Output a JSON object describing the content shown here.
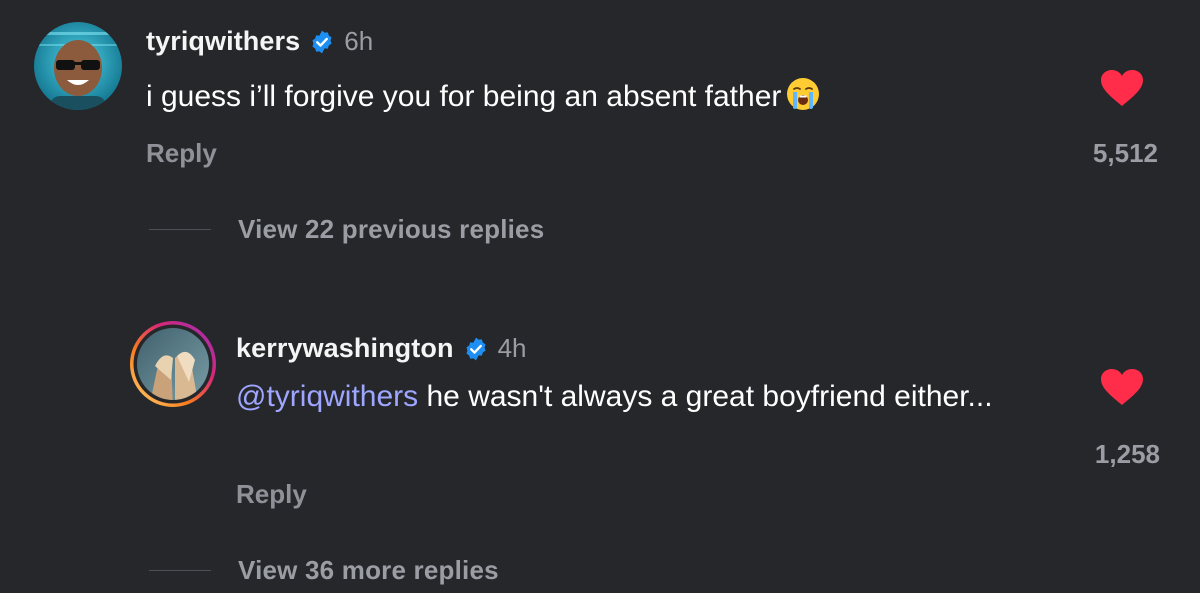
{
  "comments": [
    {
      "username": "tyriqwithers",
      "verified": true,
      "time": "6h",
      "text": "i guess i’ll forgive you for being an absent father",
      "emoji": "loudly-crying-face",
      "reply_label": "Reply",
      "likes": "5,512",
      "liked": true
    }
  ],
  "view_previous": "View 22 previous replies",
  "replies": [
    {
      "username": "kerrywashington",
      "verified": true,
      "time": "4h",
      "mention": "@tyriqwithers",
      "text": " he wasn't always a great boyfriend either...",
      "reply_label": "Reply",
      "likes": "1,258",
      "liked": true,
      "has_story_ring": true
    }
  ],
  "view_more": "View 36 more replies",
  "colors": {
    "background": "#25272b",
    "like_red": "#ff2d49",
    "verified_blue": "#1d8ff2",
    "mention": "#9ea6ff",
    "muted": "#9a9da3"
  }
}
